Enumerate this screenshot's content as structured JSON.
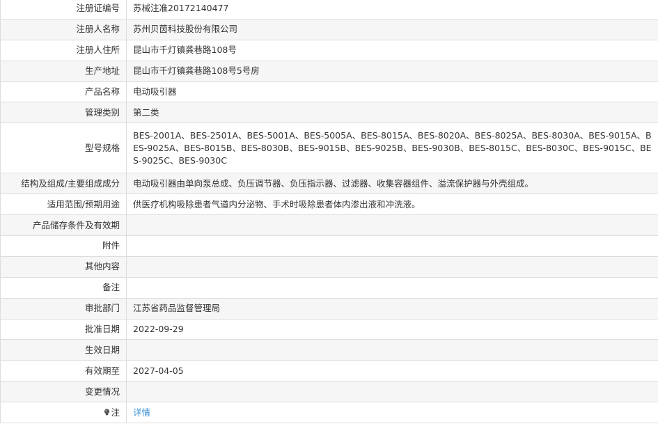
{
  "rows": [
    {
      "key": "reg_no",
      "label": "注册证编号",
      "value": "苏械注准20172140477"
    },
    {
      "key": "registrant",
      "label": "注册人名称",
      "value": "苏州贝茵科技股份有限公司"
    },
    {
      "key": "address",
      "label": "注册人住所",
      "value": "昆山市千灯镇龚巷路108号"
    },
    {
      "key": "production",
      "label": "生产地址",
      "value": "昆山市千灯镇龚巷路108号5号房"
    },
    {
      "key": "product_name",
      "label": "产品名称",
      "value": "电动吸引器"
    },
    {
      "key": "category",
      "label": "管理类别",
      "value": "第二类"
    },
    {
      "key": "models",
      "label": "型号规格",
      "value": "BES-2001A、BES-2501A、BES-5001A、BES-5005A、BES-8015A、BES-8020A、BES-8025A、BES-8030A、BES-9015A、BES-9025A、BES-8015B、BES-8030B、BES-9015B、BES-9025B、BES-9030B、BES-8015C、BES-8030C、BES-9015C、BES-9025C、BES-9030C"
    },
    {
      "key": "structure",
      "label": "结构及组成/主要组成成分",
      "value": "电动吸引器由单向泵总成、负压调节器、负压指示器、过滤器、收集容器组件、溢流保护器与外壳组成。"
    },
    {
      "key": "usage",
      "label": "适用范围/预期用途",
      "value": "供医疗机构吸除患者气道内分泌物、手术时吸除患者体内渗出液和冲洗液。"
    },
    {
      "key": "storage",
      "label": "产品储存条件及有效期",
      "value": ""
    },
    {
      "key": "attachment",
      "label": "附件",
      "value": ""
    },
    {
      "key": "other",
      "label": "其他内容",
      "value": ""
    },
    {
      "key": "remark",
      "label": "备注",
      "value": ""
    },
    {
      "key": "dept",
      "label": "审批部门",
      "value": "江苏省药品监督管理局"
    },
    {
      "key": "approve_date",
      "label": "批准日期",
      "value": "2022-09-29"
    },
    {
      "key": "effective_date",
      "label": "生效日期",
      "value": ""
    },
    {
      "key": "valid_until",
      "label": "有效期至",
      "value": "2027-04-05"
    },
    {
      "key": "changes",
      "label": "变更情况",
      "value": ""
    }
  ],
  "note": {
    "label": "注",
    "link_text": "详情",
    "icon": "lightbulb-icon"
  }
}
